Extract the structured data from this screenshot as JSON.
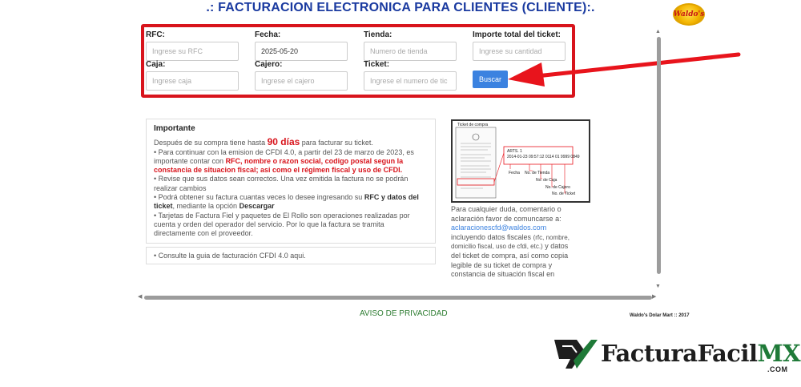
{
  "header": {
    "title": ".: FACTURACION ELECTRONICA PARA CLIENTES (CLIENTE):.",
    "logo_text": "Waldo's"
  },
  "form": {
    "rfc": {
      "label": "RFC:",
      "placeholder": "Ingrese su RFC",
      "value": ""
    },
    "fecha": {
      "label": "Fecha:",
      "placeholder": "",
      "value": "2025-05-20"
    },
    "tienda": {
      "label": "Tienda:",
      "placeholder": "Numero de tienda",
      "value": ""
    },
    "importe": {
      "label": "Importe total del ticket:",
      "placeholder": "Ingrese su cantidad",
      "value": ""
    },
    "caja": {
      "label": "Caja:",
      "placeholder": "Ingrese caja",
      "value": ""
    },
    "cajero": {
      "label": "Cajero:",
      "placeholder": "Ingrese el cajero",
      "value": ""
    },
    "ticket": {
      "label": "Ticket:",
      "placeholder": "Ingrese el numero de tic",
      "value": ""
    },
    "buscar_label": "Buscar"
  },
  "info": {
    "heading": "Importante",
    "p1_pre": "Después de su compra tiene hasta ",
    "p1_days": "90 días",
    "p1_post": " para facturar su ticket.",
    "p2_pre": "• Para continuar con la emision de CFDI 4.0, a partir del 23 de marzo de 2023, es importante contar con ",
    "p2_red": "RFC, nombre o razon social, codigo postal segun la constancia de situacion fiscal; asi como el régimen fiscal y uso de CFDI.",
    "p3": "• Revise que sus datos sean correctos. Una vez emitida la factura no se podrán realizar cambios",
    "p4_pre": "• Podrá obtener su factura cuantas veces lo desee ingresando su ",
    "p4_bold": "RFC y datos del ticket",
    "p4_mid": ", mediante la opción ",
    "p4_bold2": "Descargar",
    "p5": "• Tarjetas de Factura Fiel y paquetes de El Rollo son operaciones realizadas por cuenta y orden del operador del servicio. Por lo que la factura se tramita directamente con el proveedor.",
    "guia": "• Consulte la guia de facturación CFDI 4.0 aqui."
  },
  "ticket_image": {
    "title": "Ticket de compra",
    "line1": "ARTS. 1",
    "line2": "2014-01-23  09:57:12  0114  01  9999  0849",
    "label_fecha": "Fecha",
    "label_tienda": "No. de Tienda",
    "label_caja": "No. de Caja",
    "label_cajero": "No. de Cajero",
    "label_ticket": "No. de Ticket"
  },
  "contact": {
    "line1": "Para cualquier duda, comentario o aclaración favor de comuncarse a:",
    "email": "aclaracionescfd@waldos.com",
    "line2": "incluyendo datos fiscales",
    "line2_small": "(rfc, nombre, domicilio fiscal, uso de cfdi, etc.)",
    "line3": "y datos del ticket de compra, así como copia legible de su ticket de compra y constancia de situación fiscal en"
  },
  "footer": {
    "privacy": "AVISO DE PRIVACIDAD",
    "copyright": "Waldo's Dolar Mart :: 2017"
  },
  "brand": {
    "name_a": "FacturaFacil",
    "name_b": "MX",
    "suffix": ".COM"
  },
  "colors": {
    "title_blue": "#1a3aa0",
    "highlight_red": "#d8141c",
    "button_blue": "#3b82e0",
    "privacy_green": "#2e7d32"
  }
}
